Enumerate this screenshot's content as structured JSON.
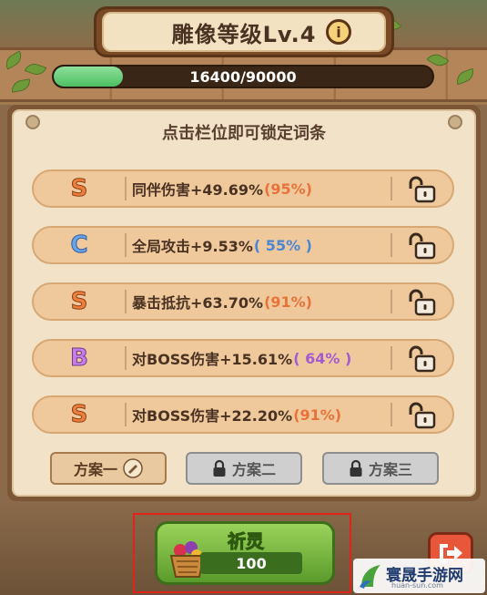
{
  "header": {
    "title": "雕像等级Lv.4",
    "info_icon": "info-icon"
  },
  "progress": {
    "text": "16400/90000",
    "current": 16400,
    "max": 90000,
    "fraction": 0.182
  },
  "panel": {
    "hint": "点击栏位即可锁定词条"
  },
  "affixes": [
    {
      "grade": "S",
      "text": "同伴伤害+49.69%",
      "pct": "(95%)",
      "pct_color": "#e8733a",
      "locked": false
    },
    {
      "grade": "C",
      "text": "全局攻击+9.53%",
      "pct": "( 55% )",
      "pct_color": "#4a86d8",
      "locked": false
    },
    {
      "grade": "S",
      "text": "暴击抵抗+63.70%",
      "pct": "(91%)",
      "pct_color": "#e8733a",
      "locked": false
    },
    {
      "grade": "B",
      "text": "对BOSS伤害+15.61%",
      "pct": "( 64% )",
      "pct_color": "#a35bd0",
      "locked": false
    },
    {
      "grade": "S",
      "text": "对BOSS伤害+22.20%",
      "pct": "(91%)",
      "pct_color": "#e8733a",
      "locked": false
    }
  ],
  "plans": [
    {
      "label": "方案一",
      "state": "active",
      "icon": "edit-pencil-icon"
    },
    {
      "label": "方案二",
      "state": "locked",
      "icon": "padlock-icon"
    },
    {
      "label": "方案三",
      "state": "locked",
      "icon": "padlock-icon"
    }
  ],
  "pray_button": {
    "label": "祈灵",
    "cost": "100",
    "icon": "gift-basket-icon"
  },
  "exit_button": {
    "icon": "exit-arrow-icon"
  },
  "watermark": {
    "text": "寰晟手游网",
    "sub": "huan-sun.com"
  },
  "colors": {
    "grade_S": "#ee7f3a",
    "grade_C": "#6aa2e6",
    "grade_B": "#c77ee8",
    "progress_fill": "#4cbf63"
  }
}
